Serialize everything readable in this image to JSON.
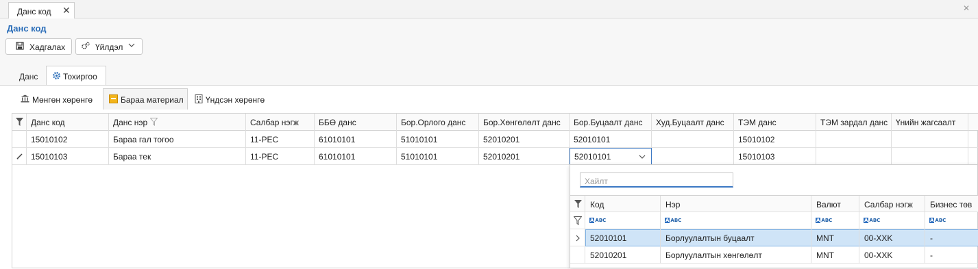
{
  "doc_tab": {
    "label": "Данс код",
    "close": "✕"
  },
  "page_title": "Данс код",
  "toolbar": {
    "save_label": "Хадгалах",
    "action_label": "Үйлдэл"
  },
  "main_tabs": [
    {
      "label": "Данс"
    },
    {
      "label": "Тохиргоо"
    }
  ],
  "sub_tabs": [
    {
      "label": "Мөнгөн хөрөнгө"
    },
    {
      "label": "Бараа материал"
    },
    {
      "label": "Үндсэн хөрөнгө"
    }
  ],
  "grid": {
    "columns": [
      "Данс код",
      "Данс нэр",
      "Салбар нэгж",
      "ББӨ данс",
      "Бор.Орлого данс",
      "Бор.Хөнгөлөлт данс",
      "Бор.Буцаалт данс",
      "Худ.Буцаалт данс",
      "ТЭМ данс",
      "ТЭМ зардал данс",
      "Үнийн жагсаалт"
    ],
    "rows": [
      [
        "15010102",
        "Бараа гал тогоо",
        "11-PEC",
        "61010101",
        "51010101",
        "52010201",
        "52010101",
        "",
        "15010102",
        "",
        ""
      ],
      [
        "15010103",
        "Бараа тек",
        "11-PEC",
        "61010101",
        "51010101",
        "52010201",
        "52010101",
        "",
        "15010103",
        "",
        ""
      ]
    ]
  },
  "lookup": {
    "search_placeholder": "Хайлт",
    "columns": [
      "Код",
      "Нэр",
      "Валют",
      "Салбар нэгж",
      "Бизнес төв"
    ],
    "filter_marker": "ABC",
    "rows": [
      [
        "52010101",
        "Борлуулалтын буцаалт",
        "MNT",
        "00-XXK",
        "-"
      ],
      [
        "52010201",
        "Борлуулалтын хөнгөлөлт",
        "MNT",
        "00-XXK",
        "-"
      ]
    ]
  },
  "colors": {
    "accent": "#2a6db8",
    "selected_row": "#cfe4f7",
    "edit_border": "#3b78c4"
  }
}
